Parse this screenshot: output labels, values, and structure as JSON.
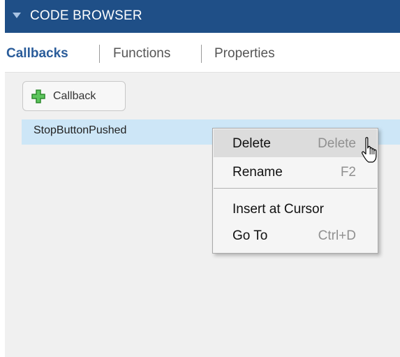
{
  "header": {
    "title": "CODE BROWSER"
  },
  "tabs": [
    {
      "label": "Callbacks",
      "active": true
    },
    {
      "label": "Functions",
      "active": false
    },
    {
      "label": "Properties",
      "active": false
    }
  ],
  "toolbar": {
    "add_label": "Callback"
  },
  "callbacks": [
    {
      "label": "StopButtonPushed",
      "selected": true
    }
  ],
  "context_menu": {
    "items": [
      {
        "label": "Delete",
        "shortcut": "Delete"
      },
      {
        "label": "Rename",
        "shortcut": "F2"
      },
      {
        "label": "Insert at Cursor",
        "shortcut": ""
      },
      {
        "label": "Go To",
        "shortcut": "Ctrl+D"
      }
    ]
  },
  "colors": {
    "header_bg": "#1f4f87",
    "active_tab": "#2a5c9a",
    "selection": "#cde6f7",
    "plus_icon": "#3aa83a"
  },
  "icons": [
    "collapse-arrow-icon",
    "plus-icon",
    "hand-pointer-cursor-icon"
  ]
}
